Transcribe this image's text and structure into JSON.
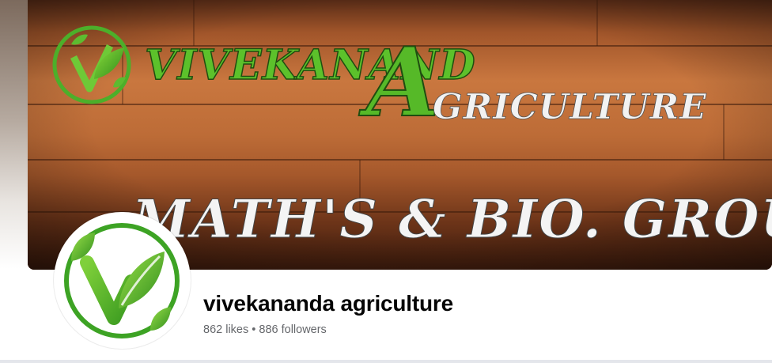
{
  "cover": {
    "brand_word_1": "VIVEKANAND",
    "brand_letter": "A",
    "brand_word_2": "GRICULTURE",
    "tagline": "MATH'S & BIO. GROUP",
    "wood_dark": "#4a2313",
    "wood_light": "#c5753f",
    "brand_green": "#4caf2a"
  },
  "profile": {
    "name": "vivekananda agriculture",
    "likes_text": "862 likes",
    "separator": "•",
    "followers_text": "886 followers"
  },
  "icons": {
    "logo": "leaf-v-logo-icon"
  }
}
